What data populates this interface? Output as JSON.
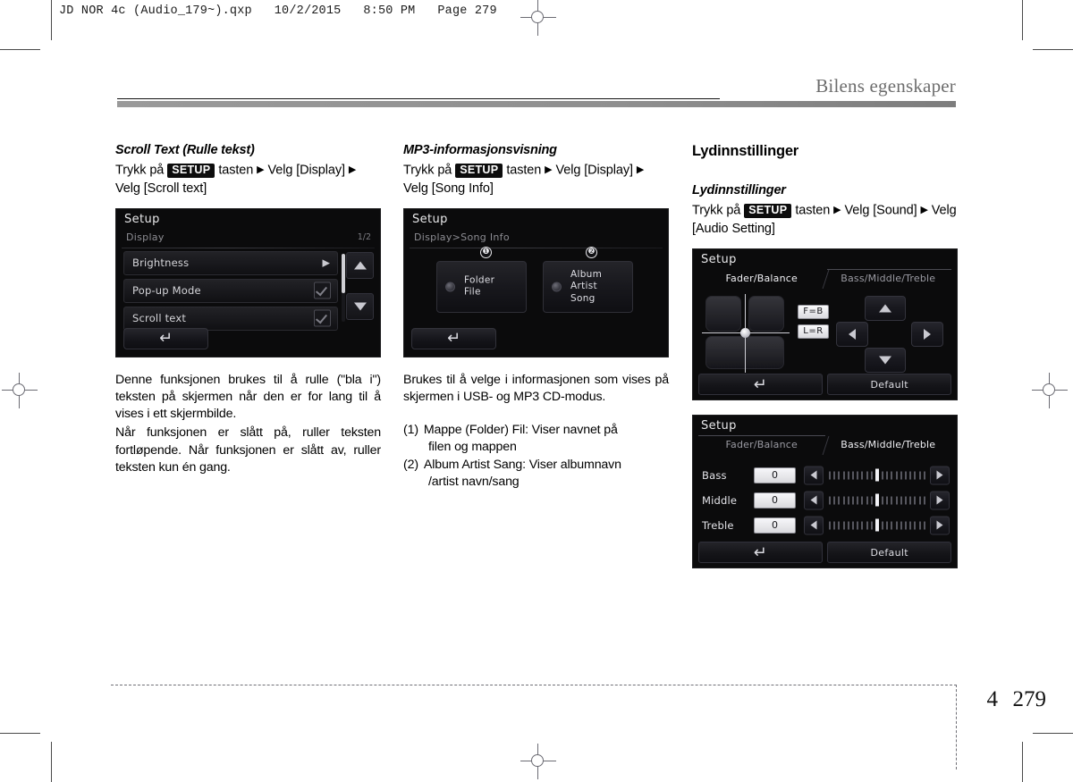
{
  "print_header": "JD NOR 4c (Audio_179~).qxp   10/2/2015   8:50 PM   Page 279",
  "running_head": "Bilens egenskaper",
  "footer": {
    "chapter": "4",
    "page": "279"
  },
  "columns": {
    "left": {
      "heading": "Scroll Text (Rulle tekst)",
      "path_prefix": "Trykk på",
      "setup_key": "SETUP",
      "path_mid": "tasten",
      "path_step1": "Velg [Display]",
      "path_step2": "Velg [Scroll text]",
      "screen": {
        "title": "Setup",
        "breadcrumb": "Display",
        "page_indicator": "1/2",
        "rows": [
          {
            "label": "Brightness",
            "control": "arrow"
          },
          {
            "label": "Pop-up Mode",
            "control": "check"
          },
          {
            "label": "Scroll text",
            "control": "check"
          }
        ],
        "back_icon": "back-arrow-icon",
        "up_icon": "scroll-up-icon",
        "down_icon": "scroll-down-icon"
      },
      "body_1": "Denne funksjonen brukes til å rulle (\"bla i\") teksten på skjermen når den er for lang til å vises i ett skjermbilde.",
      "body_2": "Når funksjonen er slått på, ruller teksten fortløpende. Når funksjonen er slått av, ruller teksten kun én gang."
    },
    "middle": {
      "heading": "MP3-informasjonsvisning",
      "path_prefix": "Trykk på",
      "setup_key": "SETUP",
      "path_mid": "tasten",
      "path_step1": "Velg [Display]",
      "path_step2": "Velg [Song Info]",
      "screen": {
        "title": "Setup",
        "breadcrumb": "Display>Song Info",
        "options": [
          {
            "callout": "❶",
            "lines": [
              "Folder",
              "File"
            ]
          },
          {
            "callout": "❷",
            "lines": [
              "Album",
              "Artist",
              "Song"
            ]
          }
        ],
        "back_icon": "back-arrow-icon"
      },
      "body_1": "Brukes til å velge i informasjonen som vises på skjermen i USB- og MP3 CD-modus.",
      "list": [
        {
          "marker": "(1)",
          "text": "Mappe (Folder) Fil: Viser navnet på",
          "cont": "filen og mappen"
        },
        {
          "marker": "(2)",
          "text": "Album Artist Sang: Viser albumnavn",
          "cont": "/artist navn/sang"
        }
      ]
    },
    "right": {
      "section_title": "Lydinnstillinger",
      "heading": "Lydinnstillinger",
      "path_prefix": "Trykk på",
      "setup_key": "SETUP",
      "path_mid": "tasten",
      "path_step1": "Velg [Sound]",
      "path_step2": "Velg [Audio Setting]",
      "screen_fader": {
        "title": "Setup",
        "tab_left": "Fader/Balance",
        "tab_right": "Bass/Middle/Treble",
        "active_tab": "Fader/Balance",
        "fb_button": "F=B",
        "lr_button": "L=R",
        "back_icon": "back-arrow-icon",
        "default_label": "Default",
        "pad_up_icon": "fader-up-icon",
        "pad_down_icon": "fader-down-icon",
        "pad_left_icon": "balance-left-icon",
        "pad_right_icon": "balance-right-icon",
        "seat_diagram": "car-seats-icon"
      },
      "screen_eq": {
        "title": "Setup",
        "tab_left": "Fader/Balance",
        "tab_right": "Bass/Middle/Treble",
        "active_tab": "Bass/Middle/Treble",
        "rows": [
          {
            "name": "Bass",
            "value": "0"
          },
          {
            "name": "Middle",
            "value": "0"
          },
          {
            "name": "Treble",
            "value": "0"
          }
        ],
        "back_icon": "back-arrow-icon",
        "default_label": "Default"
      }
    }
  }
}
